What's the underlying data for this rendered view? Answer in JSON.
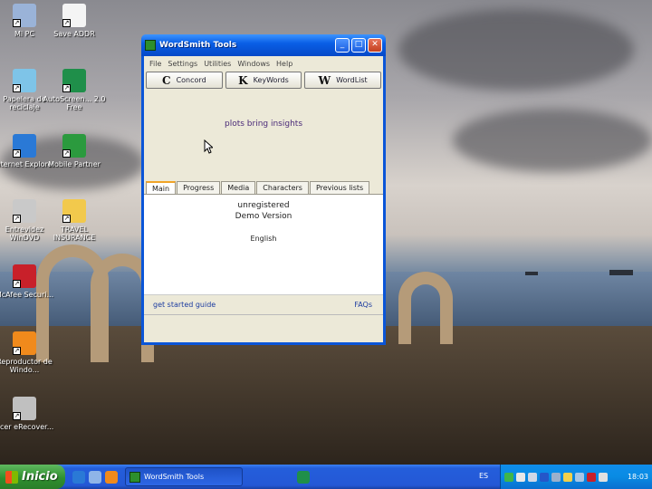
{
  "desktop": {
    "icons": [
      {
        "label": "Mi PC",
        "icon": "my-computer-icon",
        "color": "#9ab3d8"
      },
      {
        "label": "Save ADDR",
        "icon": "document-icon",
        "color": "#f4f4f4"
      },
      {
        "label": "Papelera de reciclaje",
        "icon": "recycle-bin-icon",
        "color": "#7ec4e8"
      },
      {
        "label": "AutoScreen... 2.0 Free",
        "icon": "autoscreen-icon",
        "color": "#1f8f4a"
      },
      {
        "label": "Internet Explorer",
        "icon": "internet-explorer-icon",
        "color": "#2a79d6"
      },
      {
        "label": "Mobile Partner",
        "icon": "mobile-partner-icon",
        "color": "#2b9a3e"
      },
      {
        "label": "Entrevidez WinDVD",
        "icon": "windvd-icon",
        "color": "#c9c9c9"
      },
      {
        "label": "TRAVEL INSURANCE",
        "icon": "folder-icon",
        "color": "#f2c94c"
      },
      {
        "label": "McAfee Securi...",
        "icon": "mcafee-icon",
        "color": "#c8202a"
      },
      {
        "label": "Reproductor de Windo...",
        "icon": "media-player-icon",
        "color": "#f08a1c"
      },
      {
        "label": "Acer eRecover...",
        "icon": "acer-erecovery-icon",
        "color": "#c0c0c0"
      }
    ]
  },
  "window": {
    "title": "WordSmith Tools",
    "menu": [
      "File",
      "Settings",
      "Utilities",
      "Windows",
      "Help"
    ],
    "tools": [
      {
        "letter": "C",
        "label": "Concord"
      },
      {
        "letter": "K",
        "label": "KeyWords"
      },
      {
        "letter": "W",
        "label": "WordList"
      }
    ],
    "slogan": "plots bring insights",
    "tabs": [
      "Main",
      "Progress",
      "Media",
      "Characters",
      "Previous lists"
    ],
    "active_tab": 0,
    "registration_line1": "unregistered",
    "registration_line2": "Demo Version",
    "language": "English",
    "link_left": "get started guide",
    "link_right": "FAQs"
  },
  "taskbar": {
    "start_label": "Inicio",
    "task_label": "WordSmith Tools",
    "language_indicator": "ES",
    "clock": "18:03"
  }
}
